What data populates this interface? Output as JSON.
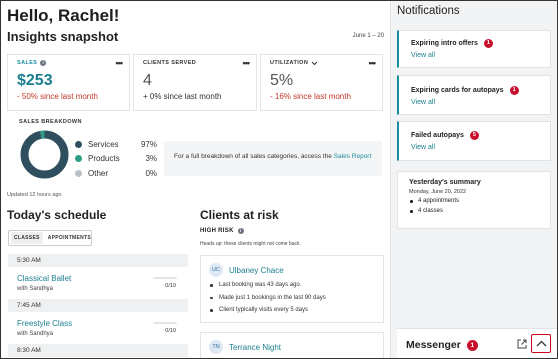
{
  "greeting": "Hello, Rachel!",
  "insights": {
    "title": "Insights snapshot",
    "date_range": "June 1 – 20",
    "updated": "Updated 12 hours ago",
    "menu_dots": "•••",
    "sales": {
      "label": "SALES",
      "value": "$253",
      "change": "- 50% since last month"
    },
    "clients_served": {
      "label": "CLIENTS SERVED",
      "value": "4",
      "change": "+ 0% since last month"
    },
    "utilization": {
      "label": "UTILIZATION",
      "value": "5%",
      "change": "- 16% since last month"
    }
  },
  "breakdown": {
    "label": "SALES BREAKDOWN",
    "items": [
      {
        "name": "Services",
        "pct": "97%",
        "color": "#2f4f5f",
        "fraction": 0.97
      },
      {
        "name": "Products",
        "pct": "3%",
        "color": "#2e9b85",
        "fraction": 0.03
      },
      {
        "name": "Other",
        "pct": "0%",
        "color": "#b9c1c6",
        "fraction": 0
      }
    ],
    "note_text": "For a full breakdown of all sales categories, access the ",
    "note_link": "Sales Report"
  },
  "schedule": {
    "title": "Today's schedule",
    "tabs": [
      "CLASSES",
      "APPOINTMENTS"
    ],
    "slots": [
      {
        "time": "5:30 AM",
        "class": "Classical Ballet",
        "teacher": "with Sandhya",
        "capacity": "0/10"
      },
      {
        "time": "7:45 AM",
        "class": "Freestyle Class",
        "teacher": "with Sandhya",
        "capacity": "0/10"
      },
      {
        "time": "8:30 AM"
      }
    ]
  },
  "risk": {
    "title": "Clients at risk",
    "level": "HIGH RISK",
    "note": "Heads up: these clients might not come back.",
    "clients": [
      {
        "initials": "UC",
        "name": "Ulbaney Chace",
        "facts": [
          "Last booking was 43 days ago.",
          "Made just 1 bookings in the last 90 days",
          "Client typically visits every 5 days"
        ]
      },
      {
        "initials": "TN",
        "name": "Terrance Night",
        "facts": []
      }
    ]
  },
  "notifications": {
    "title": "Notifications",
    "items": [
      {
        "title": "Expiring intro offers",
        "count": "1",
        "action": "View all"
      },
      {
        "title": "Expiring cards for autopays",
        "count": "1",
        "action": "View all"
      },
      {
        "title": "Failed autopays",
        "count": "5",
        "action": "View all"
      }
    ],
    "summary": {
      "title": "Yesterday's summary",
      "date": "Monday, June 20, 2022",
      "items": [
        "4 appointments",
        "4 classes"
      ]
    }
  },
  "messenger": {
    "title": "Messenger",
    "count": "1"
  }
}
